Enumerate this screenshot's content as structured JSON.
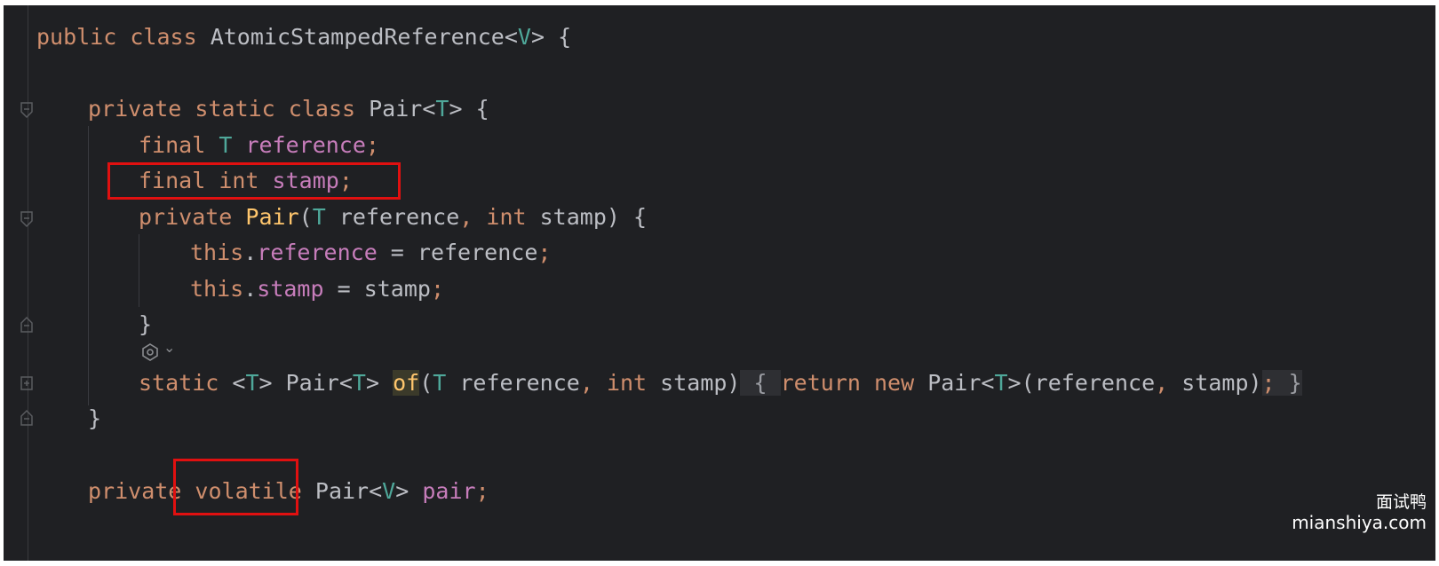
{
  "code": {
    "line1": {
      "kw1": "public",
      "kw2": "class",
      "name": "AtomicStampedReference",
      "lt": "<",
      "tp": "V",
      "gt": "> {"
    },
    "line3": {
      "kw1": "private",
      "kw2": "static",
      "kw3": "class",
      "name": "Pair",
      "lt": "<",
      "tp": "T",
      "gt": "> {"
    },
    "line4": {
      "kw": "final",
      "tp": "T",
      "fld": "reference",
      "semi": ";"
    },
    "line5": {
      "kw1": "final",
      "kw2": "int",
      "fld": "stamp",
      "semi": ";"
    },
    "line6": {
      "kw": "private",
      "fn": "Pair",
      "p1": "(",
      "tp": "T",
      "p2": " reference",
      "comma": ",",
      "kw2": "int",
      "p3": " stamp) {"
    },
    "line7": {
      "kw": "this",
      "dot": ".",
      "fld": "reference",
      "rest": " = reference",
      "semi": ";"
    },
    "line8": {
      "kw": "this",
      "dot": ".",
      "fld": "stamp",
      "rest": " = stamp",
      "semi": ";"
    },
    "line9": {
      "brace": "}"
    },
    "line10": {
      "kw": "static",
      "lt": "<",
      "tp1": "T",
      "gt1": ">",
      "name": " Pair",
      "lt2": "<",
      "tp2": "T",
      "gt2": ">",
      "fn": "of",
      "p1": "(",
      "tp3": "T",
      "p2": " reference",
      "comma": ",",
      "kw2": "int",
      "p3": " stamp)",
      "ob": " { ",
      "kw3": "return",
      "kw4": "new",
      "name2": " Pair",
      "lt3": "<",
      "tp4": "T",
      "gt3": ">",
      "p4": "(reference",
      "comma2": ",",
      "p5": " stamp)",
      "semi": ";",
      "cb": " }"
    },
    "line11": {
      "brace": "}"
    },
    "line13": {
      "kw": "private",
      "kw2": "volatile",
      "name": " Pair",
      "lt": "<",
      "tp": "V",
      "gt": ">",
      "fld": "pair",
      "semi": ";"
    }
  },
  "inlay": {
    "icon": "ai-assistant-icon",
    "chevron": "⌄"
  },
  "watermark": {
    "cn": "面试鸭",
    "site": "mianshiya.com"
  },
  "colors": {
    "background": "#1f2023",
    "highlight": "#e01010"
  }
}
